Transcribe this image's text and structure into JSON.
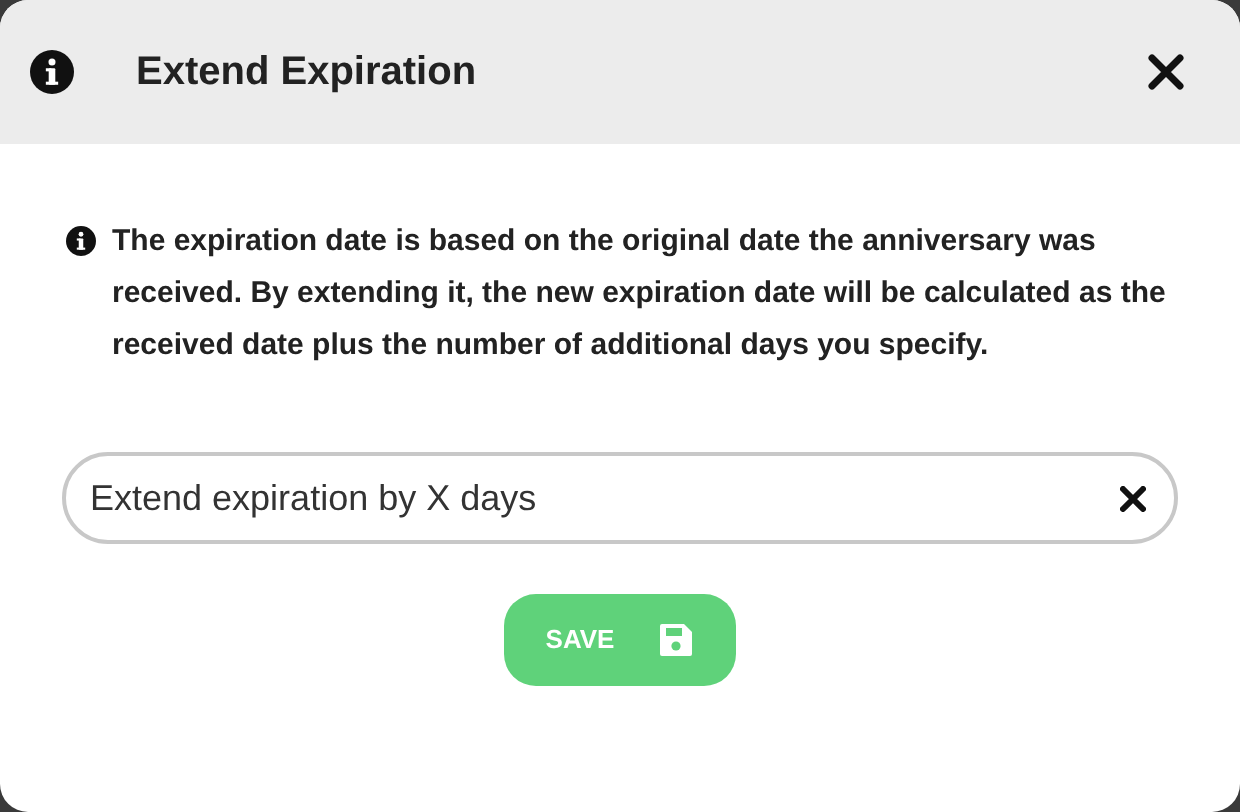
{
  "dialog": {
    "title": "Extend Expiration",
    "message": "The expiration date is based on the original date the anniversary was received. By extending it, the new expiration date will be calculated as the received date plus the number of additional days you specify.",
    "field": {
      "placeholder": "Extend expiration by X days"
    },
    "buttons": [
      {
        "label": "SAVE",
        "kind": "save"
      }
    ]
  }
}
